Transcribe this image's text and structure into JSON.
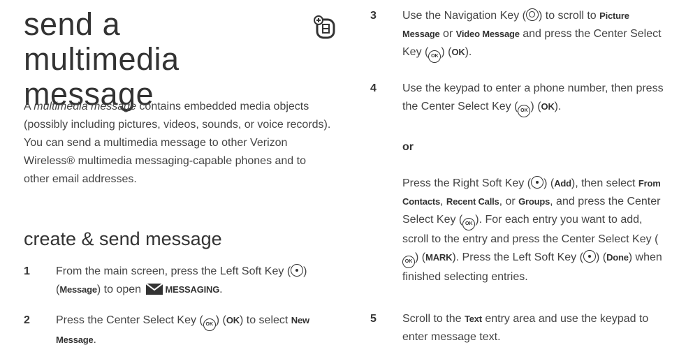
{
  "title": "send a multimedia message",
  "intro": {
    "lead": "A ",
    "term": "multimedia message",
    "rest": " contains embedded media objects (possibly including pictures, videos, sounds, or voice records). You can send a multimedia message to other Verizon Wireless® multimedia messaging-capable phones and to other email addresses."
  },
  "section_heading": "create & send message",
  "steps": [
    {
      "num": "1",
      "parts": [
        "From the main screen, press the Left Soft Key (",
        ") (",
        ") to open ",
        "."
      ],
      "ui": [
        "Message",
        "MESSAGING"
      ]
    },
    {
      "num": "2",
      "parts": [
        "Press the Center Select Key (",
        ") (",
        ") to select ",
        "."
      ],
      "ui": [
        "OK",
        "New Message"
      ]
    },
    {
      "num": "3",
      "parts": [
        "Use the Navigation Key (",
        ") to scroll to ",
        " or ",
        " and press the Center Select Key (",
        ") (",
        ")."
      ],
      "ui": [
        "Picture Message",
        "Video Message",
        "OK"
      ]
    },
    {
      "num": "4",
      "parts": [
        "Use the keypad to enter a phone number, then press the Center Select Key (",
        ") (",
        ")."
      ],
      "ui": [
        "OK"
      ],
      "or_word": "or",
      "alt_parts": [
        "Press the Right Soft Key (",
        ") (",
        "), then select ",
        ", ",
        ", or ",
        ", and press the Center Select Key (",
        "). For each entry you want to add, scroll to the entry and press the Center Select Key (",
        ") (",
        "). Press the Left Soft Key (",
        ") (",
        ") when finished selecting entries."
      ],
      "alt_ui": [
        "Add",
        "From Contacts",
        "Recent Calls",
        "Groups",
        "MARK",
        "Done"
      ]
    },
    {
      "num": "5",
      "parts": [
        "Scroll to the ",
        " entry area and use the keypad to enter message text."
      ],
      "ui": [
        "Text"
      ]
    }
  ],
  "icons": {
    "title_icon": "new-message-icon",
    "soft_key": "soft-key-icon",
    "ok_key": "center-select-key-icon",
    "ok_key_label": "OK",
    "nav_key": "navigation-key-icon",
    "messaging": "envelope-icon"
  }
}
